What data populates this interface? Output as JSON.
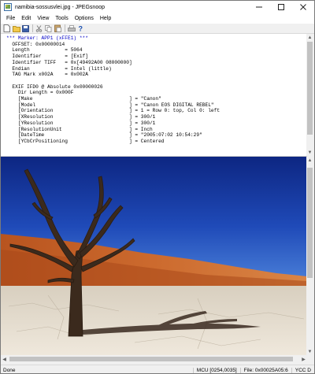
{
  "window": {
    "title": "namibia-sossusvlei.jpg - JPEGsnoop"
  },
  "menu": [
    "File",
    "Edit",
    "View",
    "Tools",
    "Options",
    "Help"
  ],
  "toolbar": {
    "icons": [
      "new-icon",
      "open-icon",
      "save-icon",
      "cut-icon",
      "copy-icon",
      "paste-icon",
      "print-icon",
      "help-icon"
    ]
  },
  "log": {
    "marker_line": "*** Marker: APP1 (xFFE1) ***",
    "lines": [
      "  OFFSET: 0x00000014",
      "  Length            = 5064",
      "  Identifier        = [Exif]",
      "  Identifier TIFF   = 0x[49492A00 08000000]",
      "  Endian            = Intel (little)",
      "  TAG Mark x002A    = 0x002A",
      "",
      "  EXIF IFD0 @ Absolute 0x00000026",
      "    Dir Length = 0x000F",
      "    [Make                                 ] = \"Canon\"",
      "    [Model                                ] = \"Canon EOS DIGITAL REBEL\"",
      "    [Orientation                          ] = 1 = Row 0: top, Col 0: left",
      "    [XResolution                          ] = 300/1",
      "    [YResolution                          ] = 300/1",
      "    [ResolutionUnit                       ] = Inch",
      "    [DateTime                             ] = \"2005:07:02 10:54:29\"",
      "    [YCbCrPositioning                     ] = Centered"
    ]
  },
  "status": {
    "left": "Done",
    "mcu": "MCU [0254,0035]",
    "file": "File: 0x00025A05:6",
    "ycc": "YCC D"
  },
  "colors": {
    "marker_text": "#0000c8",
    "sky_top": "#0f2a86",
    "dune": "#c8602a",
    "ground": "#e4dccf"
  }
}
